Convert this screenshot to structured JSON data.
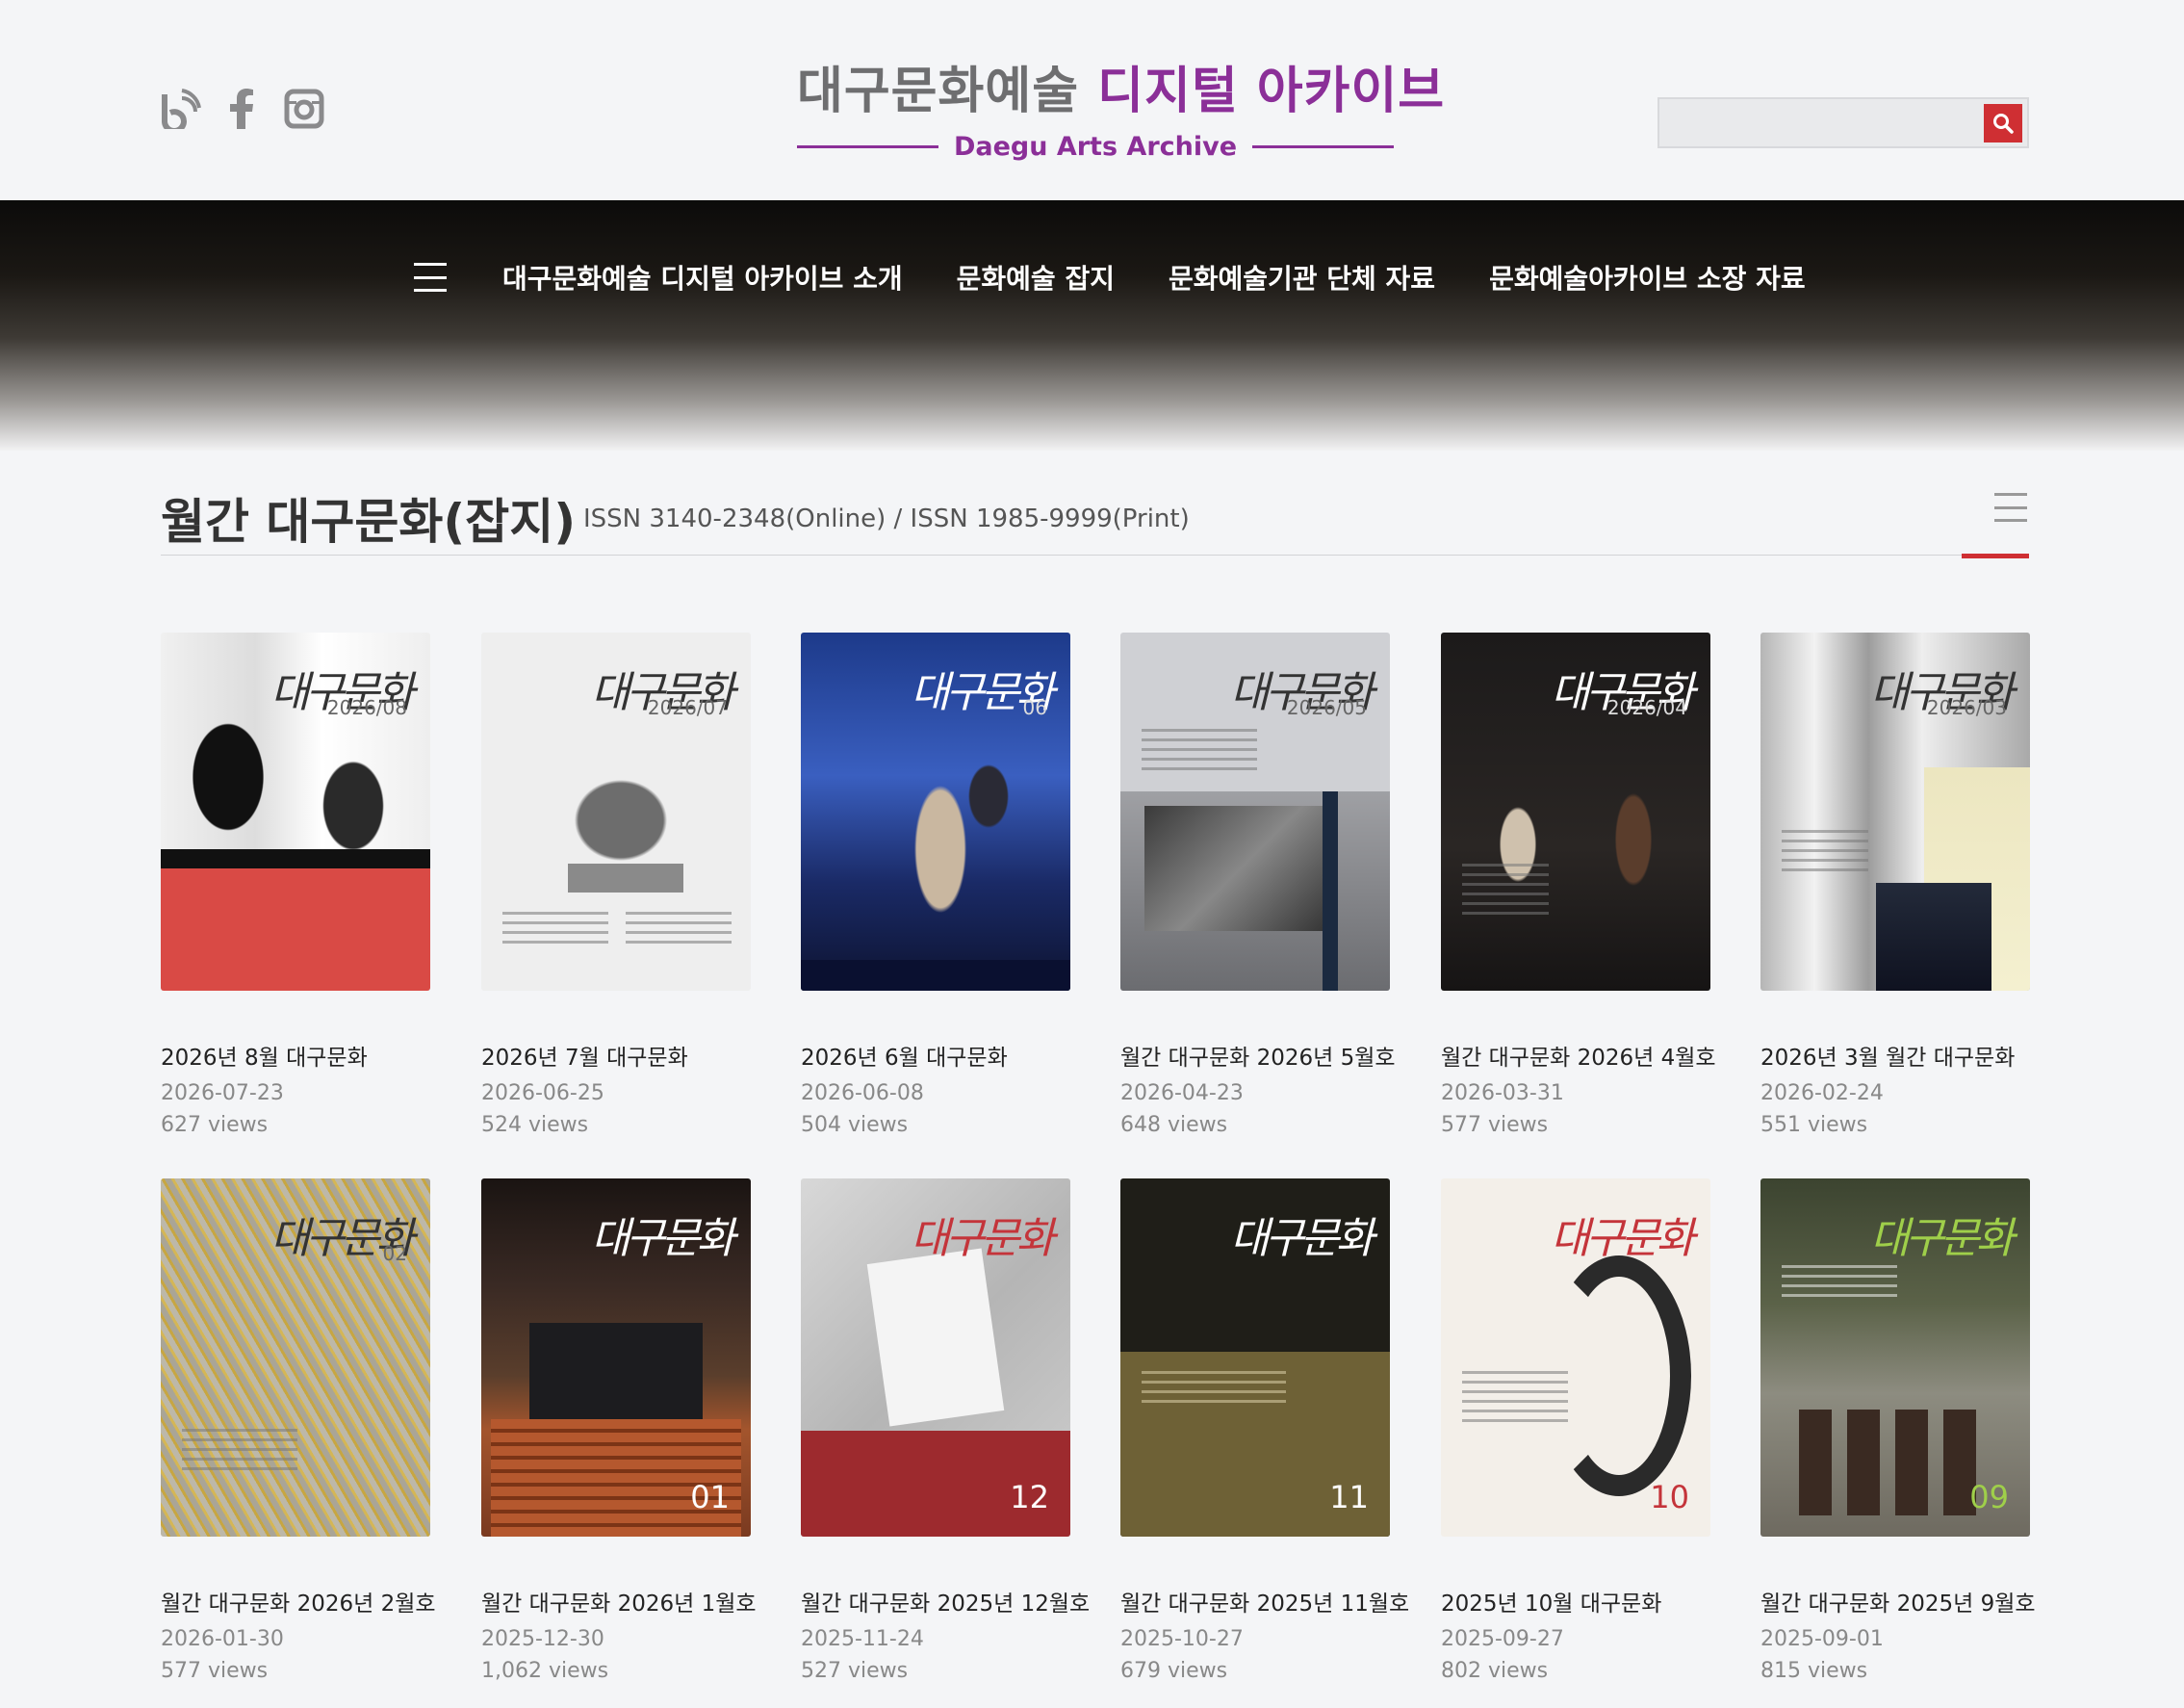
{
  "header": {
    "social": [
      {
        "icon": "blog-icon"
      },
      {
        "icon": "facebook-icon"
      },
      {
        "icon": "instagram-icon"
      }
    ],
    "logo_main_gray": "대구문화예술 ",
    "logo_main_purple": "디지털 아카이브",
    "logo_sub": "Daegu Arts Archive",
    "search_value": "",
    "search_icon": "search-icon"
  },
  "nav": {
    "menu_icon": "menu-icon",
    "items": [
      "대구문화예술 디지털 아카이브 소개",
      "문화예술 잡지",
      "문화예술기관 단체 자료",
      "문화예술아카이브 소장 자료"
    ]
  },
  "section": {
    "title": "월간 대구문화(잡지)",
    "issn": "ISSN 3140-2348(Online) / ISSN 1985-9999(Print)"
  },
  "items": [
    {
      "title": "2026년 8월 대구문화",
      "date": "2026-07-23",
      "views": "627 views",
      "cover_num": "2026/08"
    },
    {
      "title": "2026년 7월 대구문화",
      "date": "2026-06-25",
      "views": "524 views",
      "cover_num": "2026/07"
    },
    {
      "title": "2026년 6월 대구문화",
      "date": "2026-06-08",
      "views": "504 views",
      "cover_num": "06"
    },
    {
      "title": "월간 대구문화 2026년 5월호",
      "date": "2026-04-23",
      "views": "648 views",
      "cover_num": "2026/05"
    },
    {
      "title": "월간 대구문화 2026년 4월호",
      "date": "2026-03-31",
      "views": "577 views",
      "cover_num": "2026/04"
    },
    {
      "title": "2026년 3월 월간 대구문화",
      "date": "2026-02-24",
      "views": "551 views",
      "cover_num": "2026/03"
    },
    {
      "title": "월간 대구문화 2026년 2월호",
      "date": "2026-01-30",
      "views": "577 views",
      "cover_num": "02"
    },
    {
      "title": "월간 대구문화 2026년 1월호",
      "date": "2025-12-30",
      "views": "1,062 views",
      "cover_num": "01"
    },
    {
      "title": "월간 대구문화 2025년 12월호",
      "date": "2025-11-24",
      "views": "527 views",
      "cover_num": "12"
    },
    {
      "title": "월간 대구문화 2025년 11월호",
      "date": "2025-10-27",
      "views": "679 views",
      "cover_num": "11"
    },
    {
      "title": "2025년 10월 대구문화",
      "date": "2025-09-27",
      "views": "802 views",
      "cover_num": "10"
    },
    {
      "title": "월간 대구문화 2025년 9월호",
      "date": "2025-09-01",
      "views": "815 views",
      "cover_num": "09"
    }
  ],
  "colors": {
    "brand_purple": "#8b2f98",
    "accent_red": "#cf2f33"
  }
}
